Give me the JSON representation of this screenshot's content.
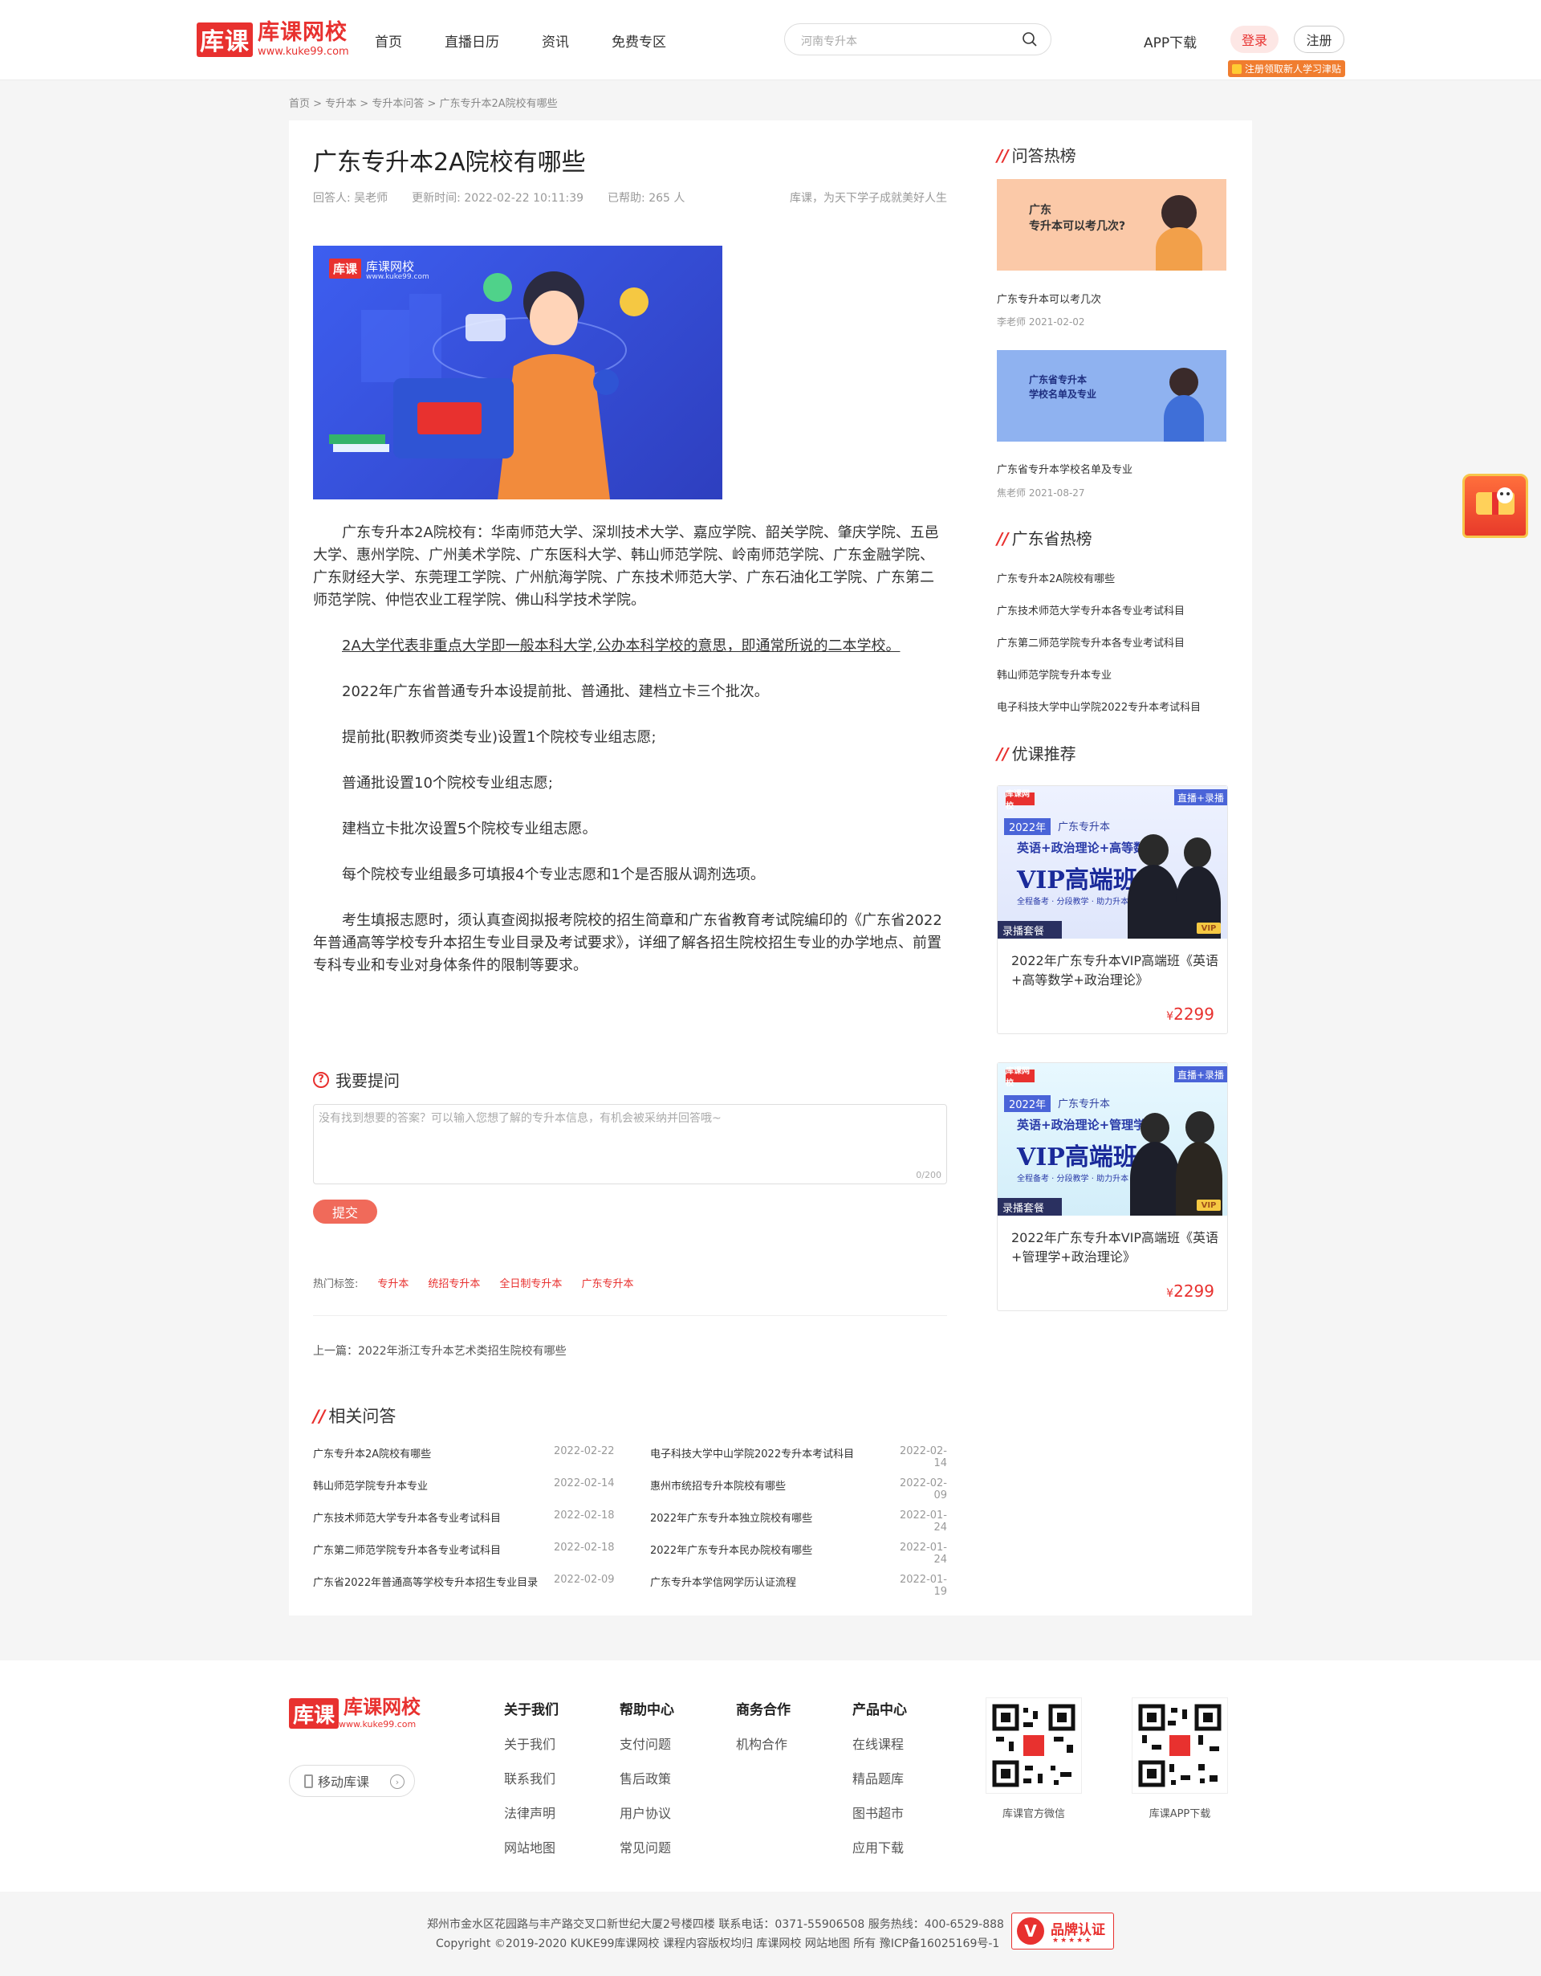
{
  "header": {
    "logo_name": "库课网校",
    "logo_box": "库课",
    "logo_url": "www.kuke99.com",
    "nav": [
      "首页",
      "直播日历",
      "资讯",
      "免费专区"
    ],
    "search_placeholder": "河南专升本",
    "app_download": "APP下载",
    "login": "登录",
    "register": "注册",
    "promo": "注册领取新人学习津贴"
  },
  "breadcrumb": "首页 > 专升本 > 专升本问答 > 广东专升本2A院校有哪些",
  "article": {
    "title": "广东专升本2A院校有哪些",
    "answerer": "回答人:  吴老师",
    "updated": "更新时间:  2022-02-22 10:11:39",
    "helped": "已帮助:  265 人",
    "slogan": "库课，为天下学子成就美好人生",
    "hero_logo_box": "库课",
    "hero_logo_name": "库课网校",
    "hero_logo_url": "www.kuke99.com",
    "paragraphs": [
      "广东专升本2A院校有：华南师范大学、深圳技术大学、嘉应学院、韶关学院、肇庆学院、五邑大学、惠州学院、广州美术学院、广东医科大学、韩山师范学院、岭南师范学院、广东金融学院、广东财经大学、东莞理工学院、广州航海学院、广东技术师范大学、广东石油化工学院、广东第二师范学院、仲恺农业工程学院、佛山科学技术学院。",
      "2A大学代表非重点大学即一般本科大学,公办本科学校的意思，即通常所说的二本学校。",
      "2022年广东省普通专升本设提前批、普通批、建档立卡三个批次。",
      "提前批(职教师资类专业)设置1个院校专业组志愿;",
      "普通批设置10个院校专业组志愿;",
      "建档立卡批次设置5个院校专业组志愿。",
      "每个院校专业组最多可填报4个专业志愿和1个是否服从调剂选项。",
      "考生填报志愿时，须认真查阅拟报考院校的招生简章和广东省教育考试院编印的《广东省2022年普通高等学校专升本招生专业目录及考试要求》，详细了解各招生院校招生专业的办学地点、前置专科专业和专业对身体条件的限制等要求。"
    ]
  },
  "ask": {
    "title": "我要提问",
    "placeholder": "没有找到想要的答案？可以输入您想了解的专升本信息，有机会被采纳并回答哦~",
    "counter": "0/200",
    "submit": "提交"
  },
  "tags": {
    "label": "热门标签:",
    "items": [
      "专升本",
      "统招专升本",
      "全日制专升本",
      "广东专升本"
    ]
  },
  "prev": "上一篇：2022年浙江专升本艺术类招生院校有哪些",
  "related": {
    "title": "相关问答",
    "rows": [
      [
        {
          "q": "广东专升本2A院校有哪些",
          "d": "2022-02-22"
        },
        {
          "q": "电子科技大学中山学院2022专升本考试科目",
          "d": "2022-02-14"
        }
      ],
      [
        {
          "q": "韩山师范学院专升本专业",
          "d": "2022-02-14"
        },
        {
          "q": "惠州市统招专升本院校有哪些",
          "d": "2022-02-09"
        }
      ],
      [
        {
          "q": "广东技术师范大学专升本各专业考试科目",
          "d": "2022-02-18"
        },
        {
          "q": "2022年广东专升本独立院校有哪些",
          "d": "2022-01-24"
        }
      ],
      [
        {
          "q": "广东第二师范学院专升本各专业考试科目",
          "d": "2022-02-18"
        },
        {
          "q": "2022年广东专升本民办院校有哪些",
          "d": "2022-01-24"
        }
      ],
      [
        {
          "q": "广东省2022年普通高等学校专升本招生专业目录",
          "d": "2022-02-09"
        },
        {
          "q": "广东专升本学信网学历认证流程",
          "d": "2022-01-19"
        }
      ]
    ]
  },
  "sidebar": {
    "hot_title": "问答热榜",
    "hot": [
      {
        "banner_l1": "广东",
        "banner_l2": "专升本可以考几次?",
        "title": "广东专升本可以考几次",
        "meta": "李老师  2021-02-02"
      },
      {
        "banner_l1": "广东省专升本",
        "banner_l2": "学校名单及专业",
        "title": "广东省专升本学校名单及专业",
        "meta": "焦老师  2021-08-27"
      }
    ],
    "prov_title": "广东省热榜",
    "prov": [
      "广东专升本2A院校有哪些",
      "广东技术师范大学专升本各专业考试科目",
      "广东第二师范学院专升本各专业考试科目",
      "韩山师范学院专升本专业",
      "电子科技大学中山学院2022专升本考试科目"
    ],
    "course_title": "优课推荐",
    "courses": [
      {
        "top": "库课网校",
        "badge": "直播+录播",
        "year": "2022年",
        "line": "广东专升本",
        "sub": "英语+政治理论+高等数学",
        "big": "VIP高端班",
        "feat": "全程备考 · 分段教学 · 助力升本",
        "rec": "录播套餐",
        "vip": "VIP",
        "title": "2022年广东专升本VIP高端班《英语+高等数学+政治理论》",
        "price": "2299",
        "currency": "¥"
      },
      {
        "top": "库课网校",
        "badge": "直播+录播",
        "year": "2022年",
        "line": "广东专升本",
        "sub": "英语+政治理论+管理学",
        "big": "VIP高端班",
        "feat": "全程备考 · 分段教学 · 助力升本",
        "rec": "录播套餐",
        "vip": "VIP",
        "title": "2022年广东专升本VIP高端班《英语+管理学+政治理论》",
        "price": "2299",
        "currency": "¥"
      }
    ]
  },
  "footer": {
    "logo_box": "库课",
    "logo_name": "库课网校",
    "logo_url": "www.kuke99.com",
    "mobile": "移动库课",
    "cols": [
      {
        "h": "关于我们",
        "items": [
          "关于我们",
          "联系我们",
          "法律声明",
          "网站地图"
        ]
      },
      {
        "h": "帮助中心",
        "items": [
          "支付问题",
          "售后政策",
          "用户协议",
          "常见问题"
        ]
      },
      {
        "h": "商务合作",
        "items": [
          "机构合作"
        ]
      },
      {
        "h": "产品中心",
        "items": [
          "在线课程",
          "精品题库",
          "图书超市",
          "应用下载"
        ]
      }
    ],
    "qr": [
      "库课官方微信",
      "库课APP下载"
    ],
    "line1": "郑州市金水区花园路与丰产路交叉口新世纪大厦2号楼四楼  联系电话：0371-55906508  服务热线：400-6529-888",
    "line2": "Copyright ©2019-2020 KUKE99库课网校 课程内容版权均归 库课网校 网站地图 所有 豫ICP备16025169号-1",
    "brand": "品牌认证",
    "brand_stars": "★★★★★"
  },
  "colors": {
    "brand": "#e8312f",
    "accent_blue": "#3d5ef0"
  }
}
